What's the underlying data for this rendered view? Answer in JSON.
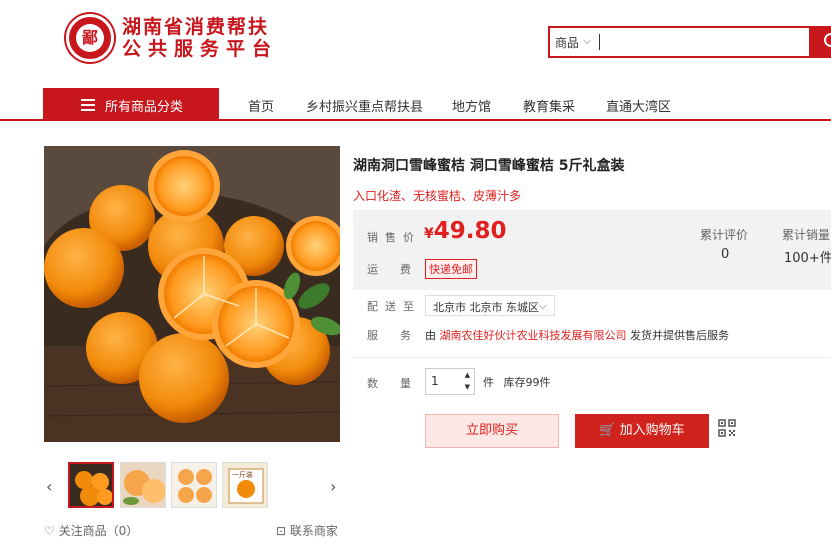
{
  "header": {
    "logo_text": "鄙",
    "brand_line1": "湖南省消费帮扶",
    "brand_line2": "公共服务平台",
    "search": {
      "category": "商品",
      "value": ""
    }
  },
  "nav": {
    "all_categories": "所有商品分类",
    "items": [
      "首页",
      "乡村振兴重点帮扶县",
      "地方馆",
      "教育集采",
      "直通大湾区"
    ]
  },
  "gallery": {
    "prev": "‹",
    "next": "›",
    "thumb_count": 4,
    "thumb4_text": "一斤装"
  },
  "product": {
    "title": "湖南洞口雪峰蜜桔 洞口雪峰蜜桔 5斤礼盒装",
    "subtitle": "入口化渣、无核蜜桔、皮薄汁多",
    "price_label": "销售价",
    "price_symbol": "¥",
    "price": "49.80",
    "shipping_label": "运费",
    "shipping": "快递免邮",
    "reviews_label": "累计评价",
    "reviews": "0",
    "sales_label": "累计销量",
    "sales": "100+件",
    "delivery_label": "配送至",
    "delivery": "北京市 北京市 东城区",
    "service_label": "服务",
    "service_prefix": "由",
    "service_company": "湖南农佳好伙计农业科技发展有限公司",
    "service_suffix": "发货并提供售后服务",
    "qty_label": "数量",
    "qty": "1",
    "qty_unit": "件",
    "stock": "库存99件",
    "buy_now": "立即购买",
    "add_cart": "加入购物车"
  },
  "footer": {
    "follow": "关注商品（0）",
    "contact": "联系商家"
  },
  "colors": {
    "brand": "#c8161d",
    "price": "#e0201f"
  }
}
